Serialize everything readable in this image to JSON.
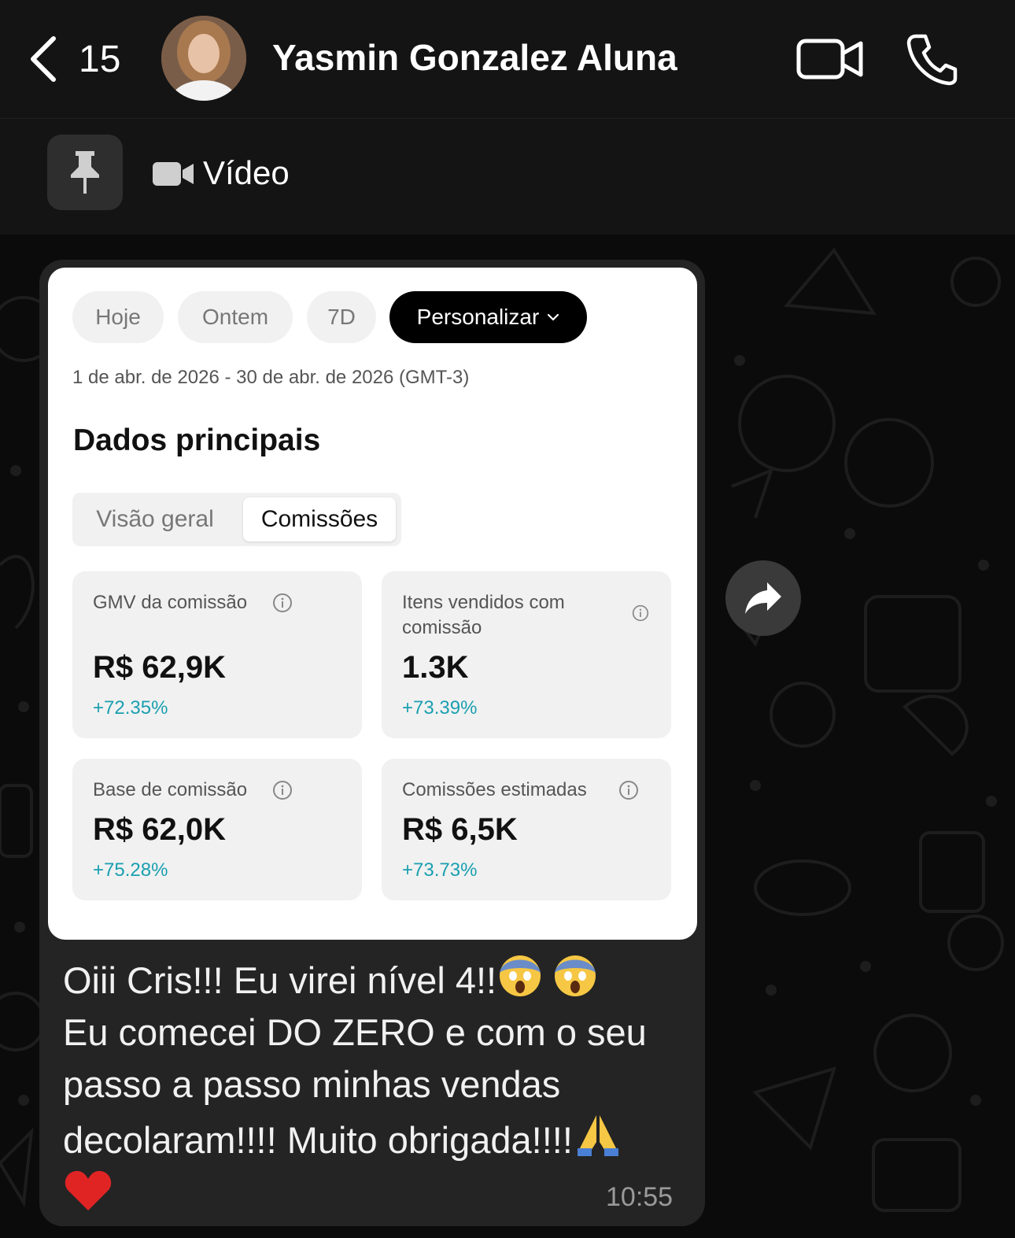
{
  "header": {
    "back_count": "15",
    "contact_name": "Yasmin Gonzalez Aluna"
  },
  "pinned": {
    "label": "Vídeo"
  },
  "shared_image": {
    "chips": [
      "Hoje",
      "Ontem",
      "7D",
      "Personalizar"
    ],
    "active_chip": "Personalizar",
    "date_range": "1 de abr. de 2026 - 30 de abr. de 2026 (GMT-3)",
    "section_title": "Dados principais",
    "tabs": [
      "Visão geral",
      "Comissões"
    ],
    "active_tab": "Comissões",
    "cards": [
      {
        "label": "GMV da comissão",
        "value": "R$ 62,9K",
        "delta": "+72.35%"
      },
      {
        "label": "Itens vendidos com comissão",
        "value": "1.3K",
        "delta": "+73.39%"
      },
      {
        "label": "Base de comissão",
        "value": "R$ 62,0K",
        "delta": "+75.28%"
      },
      {
        "label": "Comissões estimadas",
        "value": "R$ 6,5K",
        "delta": "+73.73%"
      }
    ]
  },
  "message": {
    "text_parts": [
      "Oiii Cris!!! Eu virei nível 4!!",
      "Eu comecei DO ZERO e com o seu passo a passo minhas vendas decolaram!!!! Muito obrigada!!!!"
    ],
    "time": "10:55"
  },
  "colors": {
    "header_bg": "#141414",
    "bubble_bg": "#242424",
    "delta": "#1a9fb0",
    "chip_active": "#000000"
  }
}
